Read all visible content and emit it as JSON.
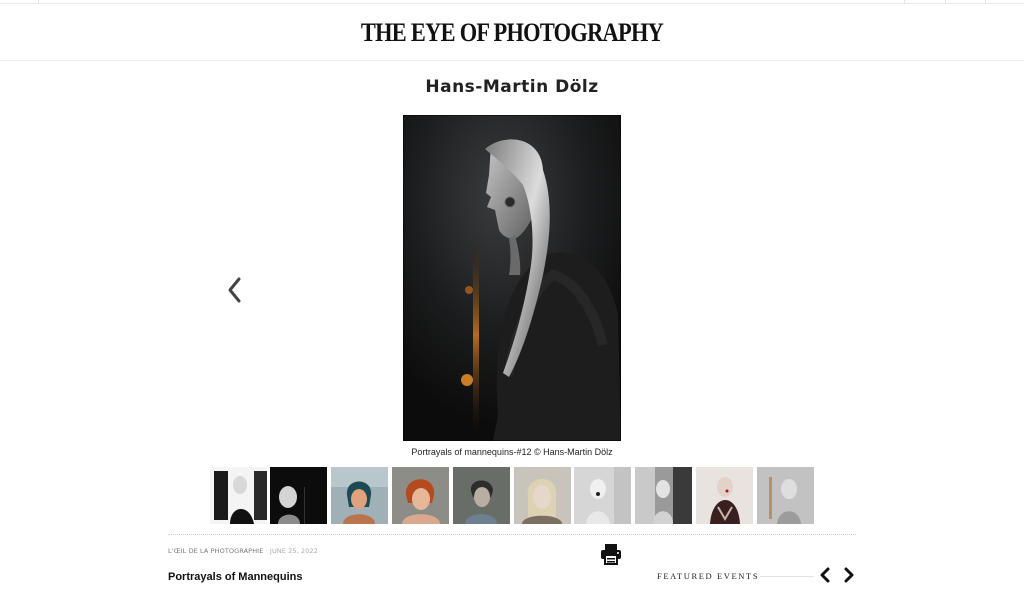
{
  "site": {
    "logo": "THE EYE OF PHOTOGRAPHY"
  },
  "gallery": {
    "title": "Hans-Martin Dölz",
    "caption": "Portrayals of mannequins-#12 © Hans-Martin Dölz",
    "prev_icon": "chevron-left-icon",
    "thumbnails": [
      "thumb-1",
      "thumb-2",
      "thumb-3",
      "thumb-4",
      "thumb-5",
      "thumb-6",
      "thumb-7",
      "thumb-8",
      "thumb-9",
      "thumb-10"
    ]
  },
  "article": {
    "source": "L'ŒIL DE LA PHOTOGRAPHIE",
    "separator": "·",
    "date": "JUNE 25, 2022",
    "title": "Portrayals of Mannequins",
    "print_icon": "printer-icon"
  },
  "featured": {
    "label": "FEATURED EVENTS",
    "prev_icon": "chevron-left-icon",
    "next_icon": "chevron-right-icon"
  },
  "colors": {
    "text": "#111111",
    "muted": "#777777",
    "light": "#a8a8a8",
    "border": "#ececec"
  }
}
